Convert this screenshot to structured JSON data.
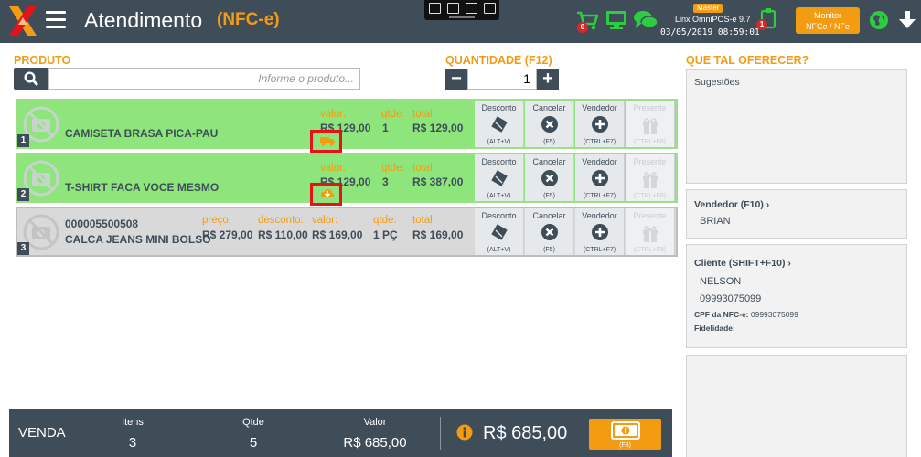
{
  "header": {
    "title": "Atendimento",
    "subtitle": "(NFC-e)",
    "cart_badge": "0",
    "alert_badge": "1",
    "store": {
      "badge": "Master",
      "name": "Linx OmniPOS-e  9.7",
      "datetime": "03/05/2019 08:59:01"
    },
    "monitor_button": [
      "Monitor",
      "NFCe / NFe"
    ]
  },
  "product_section": {
    "label": "PRODUTO",
    "search_placeholder": "Informe o produto..."
  },
  "quantity_section": {
    "label": "QUANTIDADE (F12)",
    "value": "1",
    "minus": "−",
    "plus": "+"
  },
  "labels": {
    "preco": "preço:",
    "desconto": "desconto:",
    "valor": "valor:",
    "qtde": "qtde:",
    "total": "total:"
  },
  "actions": {
    "discount": {
      "label": "Desconto",
      "key": "(ALT+V)"
    },
    "cancel": {
      "label": "Cancelar",
      "key": "(F5)"
    },
    "seller": {
      "label": "Vendedor",
      "key": "(CTRL+F7)"
    },
    "gift": {
      "label": "Presente",
      "key": "(CTRL+F8)"
    }
  },
  "items": [
    {
      "number": "1",
      "code": "",
      "name": "CAMISETA BRASA PICA-PAU",
      "valor": "R$ 129,00",
      "qtde": "1",
      "total": "R$ 129,00",
      "status_icon": "truck-icon"
    },
    {
      "number": "2",
      "code": "",
      "name": "T-SHIRT FACA VOCE MESMO",
      "valor": "R$ 129,00",
      "qtde": "3",
      "total": "R$ 387,00",
      "status_icon": "cloud-download-icon"
    },
    {
      "number": "3",
      "code": "000005500508",
      "name": "CALCA JEANS MINI BOLSO",
      "preco": "R$ 279,00",
      "desconto": "R$ 110,00",
      "valor": "R$ 169,00",
      "qtde": "1 PÇ",
      "total": "R$ 169,00"
    }
  ],
  "sidebar": {
    "title": "QUE TAL OFERECER?",
    "suggestions_title": "Sugestões",
    "seller": {
      "title": "Vendedor (F10)",
      "name": "BRIAN"
    },
    "customer": {
      "title": "Cliente (SHIFT+F10)",
      "name": "NELSON",
      "phone": "09993075099",
      "cpf_label": "CPF da NFC-e:",
      "cpf_value": "09993075099",
      "loyalty_label": "Fidelidade:"
    }
  },
  "footer": {
    "sale_label": "VENDA",
    "items_label": "Itens",
    "items_value": "3",
    "qty_label": "Qtde",
    "qty_value": "5",
    "value_label": "Valor",
    "value_value": "R$ 685,00",
    "total": "R$ 685,00",
    "pay_key": "(F3)"
  },
  "colors": {
    "dark": "#3f4d59",
    "accent": "#f39c12",
    "row_green": "#8ee57c",
    "row_gray": "#d9d9d9",
    "highlight": "#e8111a"
  }
}
